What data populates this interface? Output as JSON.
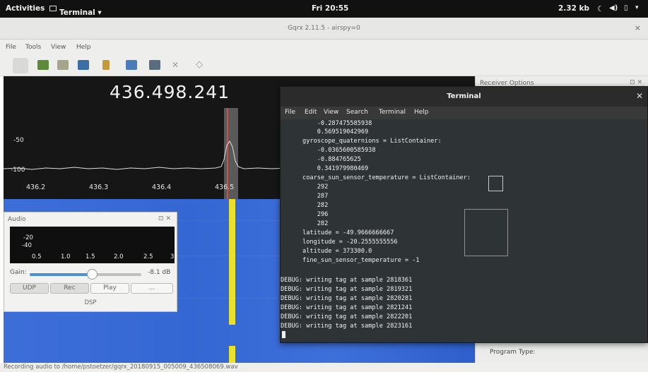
{
  "topbar": {
    "activities": "Activities",
    "app_menu": "Terminal ▾",
    "clock": "Fri 20:55",
    "network_speed": "2.32 kb",
    "tray_icons": [
      "moon-icon",
      "volume-icon",
      "battery-icon",
      "chevron-down-icon"
    ]
  },
  "window": {
    "title": "Gqrx 2.11.5 - airspy=0",
    "close": "×",
    "menu": [
      "File",
      "Tools",
      "View",
      "Help"
    ]
  },
  "plotter": {
    "frequency": "436.498.241",
    "db_labels": [
      "-50",
      "-100"
    ],
    "x_ticks": [
      "436.2",
      "436.3",
      "436.4",
      "436.5"
    ]
  },
  "receiver_dock": {
    "title": "Receiver Options",
    "program_type_label": "Program Type:"
  },
  "audio": {
    "title": "Audio",
    "dock_controls": "⊡ ✕",
    "fft_db": [
      "-20",
      "-40"
    ],
    "fft_x": [
      "0.5",
      "1.0",
      "1.5",
      "2.0",
      "2.5",
      "3"
    ],
    "gain_label": "Gain:",
    "gain_value": "-8.1 dB",
    "gain_fraction": 0.6,
    "buttons": [
      "UDP",
      "Rec",
      "Play",
      "..."
    ],
    "dsp_label": "DSP"
  },
  "terminal": {
    "title": "Terminal",
    "close": "✕",
    "menu": [
      "File",
      "Edit",
      "View",
      "Search",
      "Terminal",
      "Help"
    ],
    "lines": [
      "          -0.287475585938",
      "          0.569519042969",
      "      gyroscope_quaternions = ListContainer:",
      "          -0.0365600585938",
      "          -0.884765625",
      "          0.341979980469",
      "      coarse_sun_sensor_temperature = ListContainer:",
      "          292",
      "          287",
      "          282",
      "          296",
      "          282",
      "      latitude = -49.9666666667",
      "      longitude = -20.2555555556",
      "      altitude = 373300.0",
      "      fine_sun_sensor_temperature = -1",
      "",
      "DEBUG: writing tag at sample 2818361",
      "DEBUG: writing tag at sample 2819321",
      "DEBUG: writing tag at sample 2820281",
      "DEBUG: writing tag at sample 2821241",
      "DEBUG: writing tag at sample 2822201",
      "DEBUG: writing tag at sample 2823161"
    ]
  },
  "status_bar": {
    "text": "Recording audio to /home/pstoetzer/gqrx_20180915_005009_436508069.wav"
  },
  "colors": {
    "plot_bg": "#161616",
    "waterfall": "#3d6ed8",
    "signal": "#e9e12c",
    "terminal_bg": "#2e3436"
  }
}
